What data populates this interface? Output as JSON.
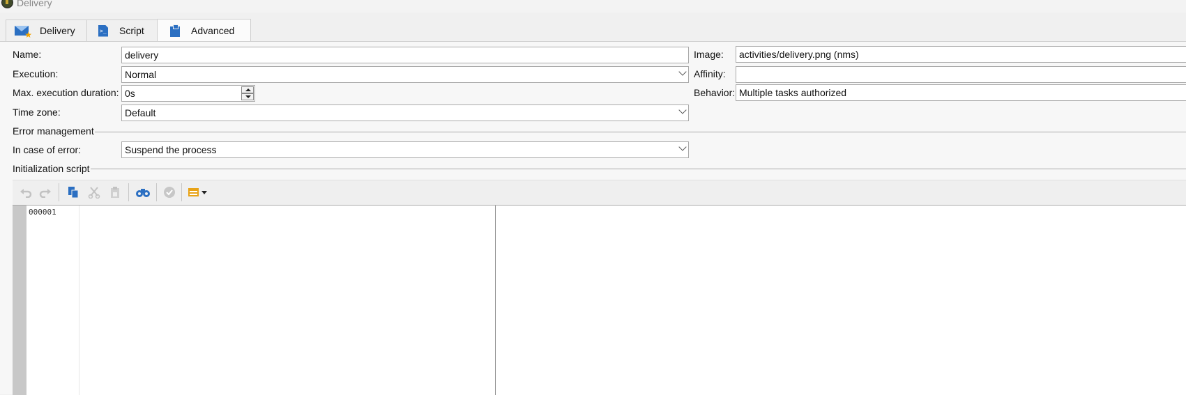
{
  "window": {
    "title": "Delivery"
  },
  "tabs": [
    {
      "label": "Delivery",
      "icon": "envelope-star-icon"
    },
    {
      "label": "Script",
      "icon": "script-icon"
    },
    {
      "label": "Advanced",
      "icon": "clipboard-icon",
      "active": true
    }
  ],
  "form": {
    "name": {
      "label": "Name:",
      "value": "delivery"
    },
    "execution": {
      "label": "Execution:",
      "value": "Normal"
    },
    "max_duration": {
      "label": "Max. execution duration:",
      "value": "0s"
    },
    "timezone": {
      "label": "Time zone:",
      "value": "Default"
    },
    "image": {
      "label": "Image:",
      "value": "activities/delivery.png (nms)"
    },
    "affinity": {
      "label": "Affinity:",
      "value": ""
    },
    "behavior": {
      "label": "Behavior:",
      "value": "Multiple tasks authorized"
    }
  },
  "error_management": {
    "heading": "Error management",
    "in_case_of_error": {
      "label": "In case of error:",
      "value": "Suspend the process"
    }
  },
  "init_script": {
    "heading": "Initialization script",
    "toolbar": [
      "undo-icon",
      "redo-icon",
      "copy-icon",
      "cut-icon",
      "paste-icon",
      "find-icon",
      "validate-icon",
      "insert-menu-icon"
    ],
    "line_numbers": [
      "000001"
    ]
  },
  "colors": {
    "accent": "#2b6fc2",
    "tab_border": "#cfcfcf",
    "field_border": "#a9a9a9",
    "gutter": "#c8c8c8"
  }
}
